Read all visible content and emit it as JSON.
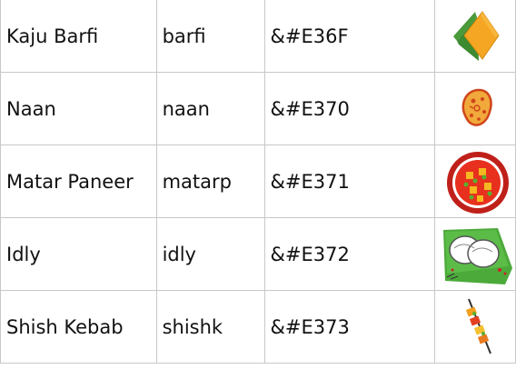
{
  "rows": [
    {
      "name": "Kaju Barfi",
      "code": "barfi",
      "entity": "&#E36F",
      "icon": "kaju-barfi-icon"
    },
    {
      "name": "Naan",
      "code": "naan",
      "entity": "&#E370",
      "icon": "naan-icon"
    },
    {
      "name": "Matar Paneer",
      "code": "matarp",
      "entity": "&#E371",
      "icon": "matar-paneer-icon"
    },
    {
      "name": "Idly",
      "code": "idly",
      "entity": "&#E372",
      "icon": "idly-icon"
    },
    {
      "name": "Shish Kebab",
      "code": "shishk",
      "entity": "&#E373",
      "icon": "shish-kebab-icon"
    }
  ]
}
